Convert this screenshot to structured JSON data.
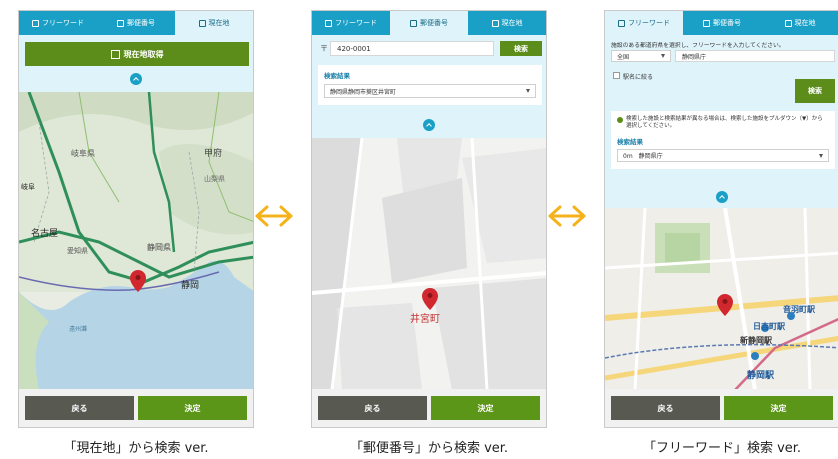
{
  "screens": [
    {
      "tabs": [
        "フリーワード",
        "郵便番号",
        "現在地"
      ],
      "active_tab": 2,
      "location_button": "現在地取得",
      "map_labels": [
        "岐阜県",
        "甲府",
        "山梨県",
        "名古屋",
        "愛知県",
        "静岡県",
        "静岡",
        "遠州灘",
        "岐阜"
      ],
      "back_label": "戻る",
      "ok_label": "決定",
      "caption": "「現在地」から検索 ver."
    },
    {
      "tabs": [
        "フリーワード",
        "郵便番号",
        "現在地"
      ],
      "active_tab": 1,
      "postal_mark": "〒",
      "postal_value": "420-0001",
      "search_label": "検索",
      "result_label": "検索結果",
      "result_value": "静岡県静岡市葵区井宮町",
      "map_label": "井宮町",
      "back_label": "戻る",
      "ok_label": "決定",
      "caption": "「郵便番号」から検索 ver."
    },
    {
      "tabs": [
        "フリーワード",
        "郵便番号",
        "現在地"
      ],
      "active_tab": 0,
      "instruction": "施設のある都道府県を選択し、フリーワードを入力してください。",
      "pref_value": "全国",
      "keyword_value": "静岡県庁",
      "station_label": "駅名に絞る",
      "search_label": "検索",
      "note": "検索した施設と検索結果が異なる場合は、検索した施設をプルダウン（▼）から選択してください。",
      "result_label": "検索結果",
      "result_value": "0m　静岡県庁",
      "map_labels": [
        "音羽町駅",
        "日吉町駅",
        "新静岡駅",
        "静岡駅"
      ],
      "back_label": "戻る",
      "ok_label": "決定",
      "caption": "「フリーワード」検索 ver."
    }
  ],
  "colors": {
    "tab": "#1aa0c6",
    "tab_active": "#dff3fa",
    "green": "#5c8c1a",
    "arrow": "#f5b21a",
    "back": "#585a52"
  }
}
